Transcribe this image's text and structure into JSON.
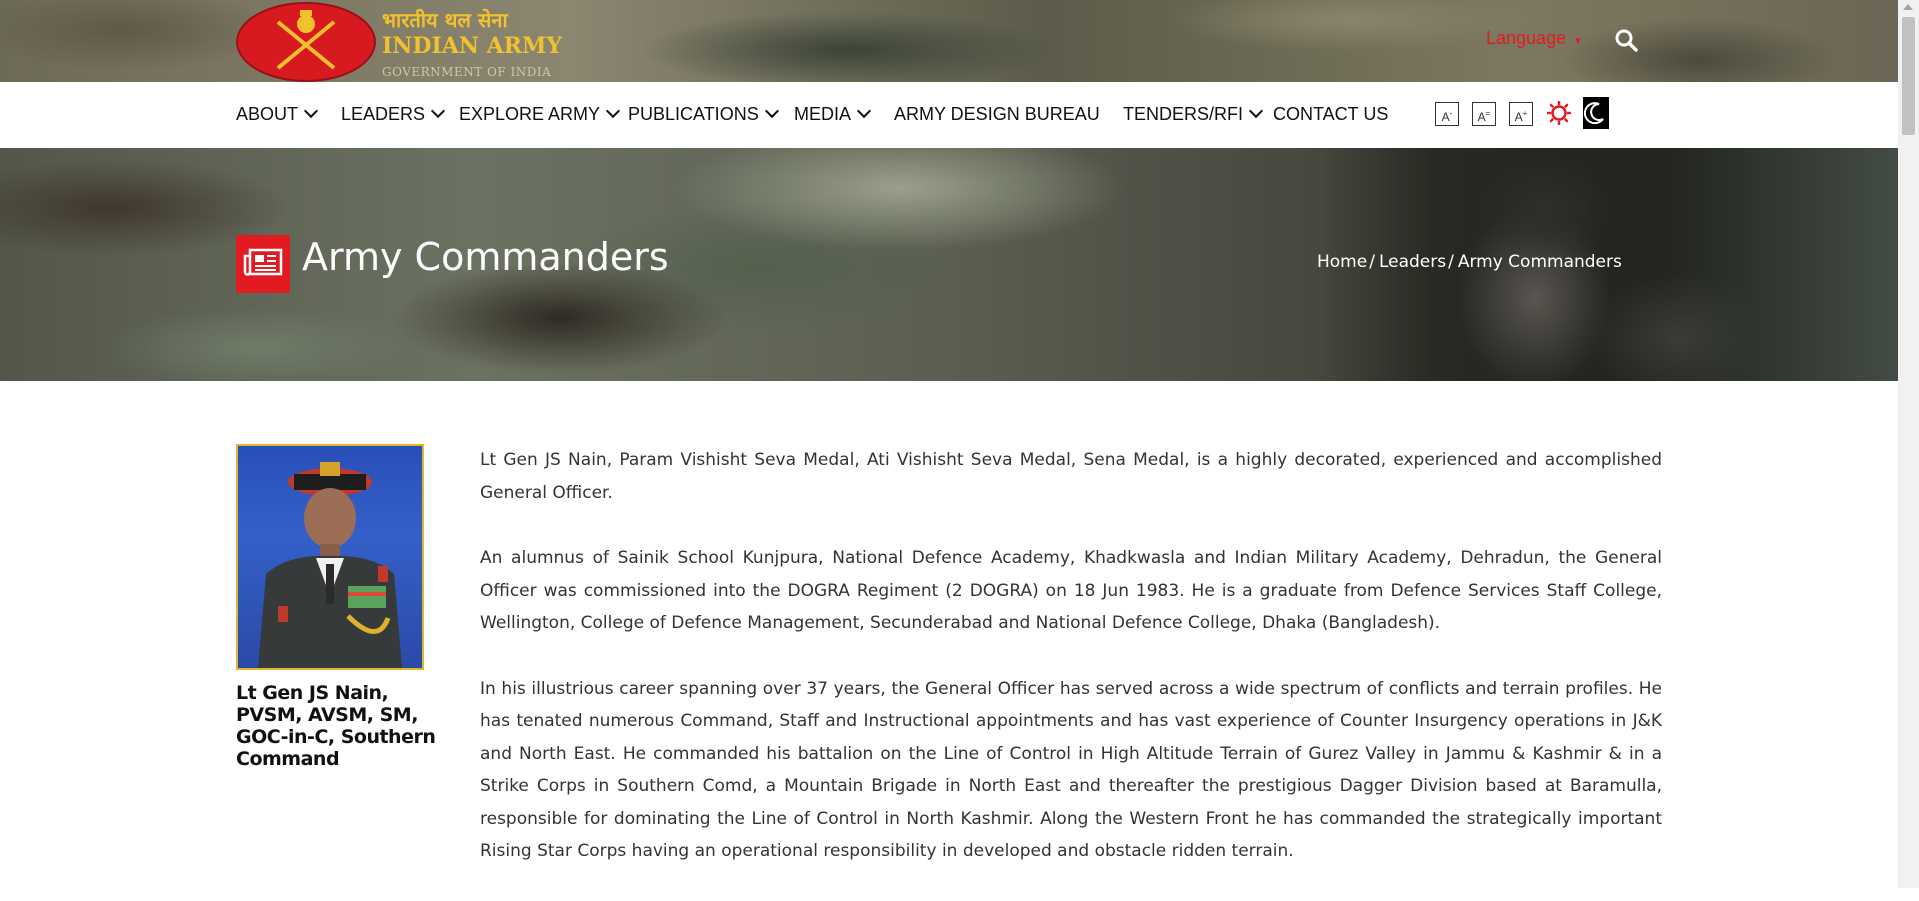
{
  "header": {
    "logo_hindi": "भारतीय थल सेना",
    "logo_english": "INDIAN ARMY",
    "logo_subtitle": "GOVERNMENT OF INDIA",
    "language_label": "Language",
    "search_icon": "search-icon"
  },
  "nav": {
    "items": [
      {
        "label": "ABOUT",
        "dropdown": true
      },
      {
        "label": "LEADERS",
        "dropdown": true
      },
      {
        "label": "EXPLORE ARMY",
        "dropdown": true
      },
      {
        "label": "PUBLICATIONS",
        "dropdown": true
      },
      {
        "label": "MEDIA",
        "dropdown": true
      },
      {
        "label": "ARMY DESIGN BUREAU",
        "dropdown": false
      },
      {
        "label": "TENDERS/RFI",
        "dropdown": true
      },
      {
        "label": "CONTACT US",
        "dropdown": false
      }
    ],
    "accessibility": {
      "decrease_font": "A",
      "normal_font": "A",
      "increase_font": "A",
      "contrast_icon": "sun-icon",
      "dark_mode_icon": "moon-icon"
    }
  },
  "banner": {
    "title": "Army Commanders",
    "icon": "newspaper-icon",
    "breadcrumb": [
      "Home",
      "Leaders",
      "Army Commanders"
    ]
  },
  "profile": {
    "name": "Lt Gen JS Nain, PVSM, AVSM, SM, GOC-in-C, Southern Command",
    "bio": [
      "Lt Gen JS Nain, Param Vishisht Seva Medal, Ati Vishisht Seva Medal, Sena Medal, is a highly decorated, experienced and accomplished General Officer.",
      "An alumnus of Sainik School Kunjpura, National Defence Academy, Khadkwasla and Indian Military Academy, Dehradun, the General Officer was commissioned into the DOGRA Regiment (2 DOGRA) on 18 Jun 1983. He is a graduate from Defence Services Staff College, Wellington, College of Defence Management, Secunderabad and National Defence College, Dhaka (Bangladesh).",
      "In his illustrious career spanning over 37 years, the General Officer has served across a wide spectrum of conflicts and terrain profiles. He has tenated numerous Command, Staff and Instructional appointments and has vast experience of Counter Insurgency operations in J&K and North East. He commanded his battalion on the Line of Control in High Altitude Terrain of Gurez Valley in Jammu & Kashmir & in a Strike Corps in Southern Comd, a Mountain Brigade in North East and thereafter the prestigious Dagger Division based at Baramulla, responsible for dominating the Line of Control in North Kashmir. Along the Western Front he has commanded the strategically important Rising Star Corps having an operational responsibility in developed and obstacle ridden terrain."
    ]
  },
  "colors": {
    "accent_red": "#e21b23",
    "logo_gold": "#f2c12e",
    "photo_border": "#e3b52a"
  }
}
